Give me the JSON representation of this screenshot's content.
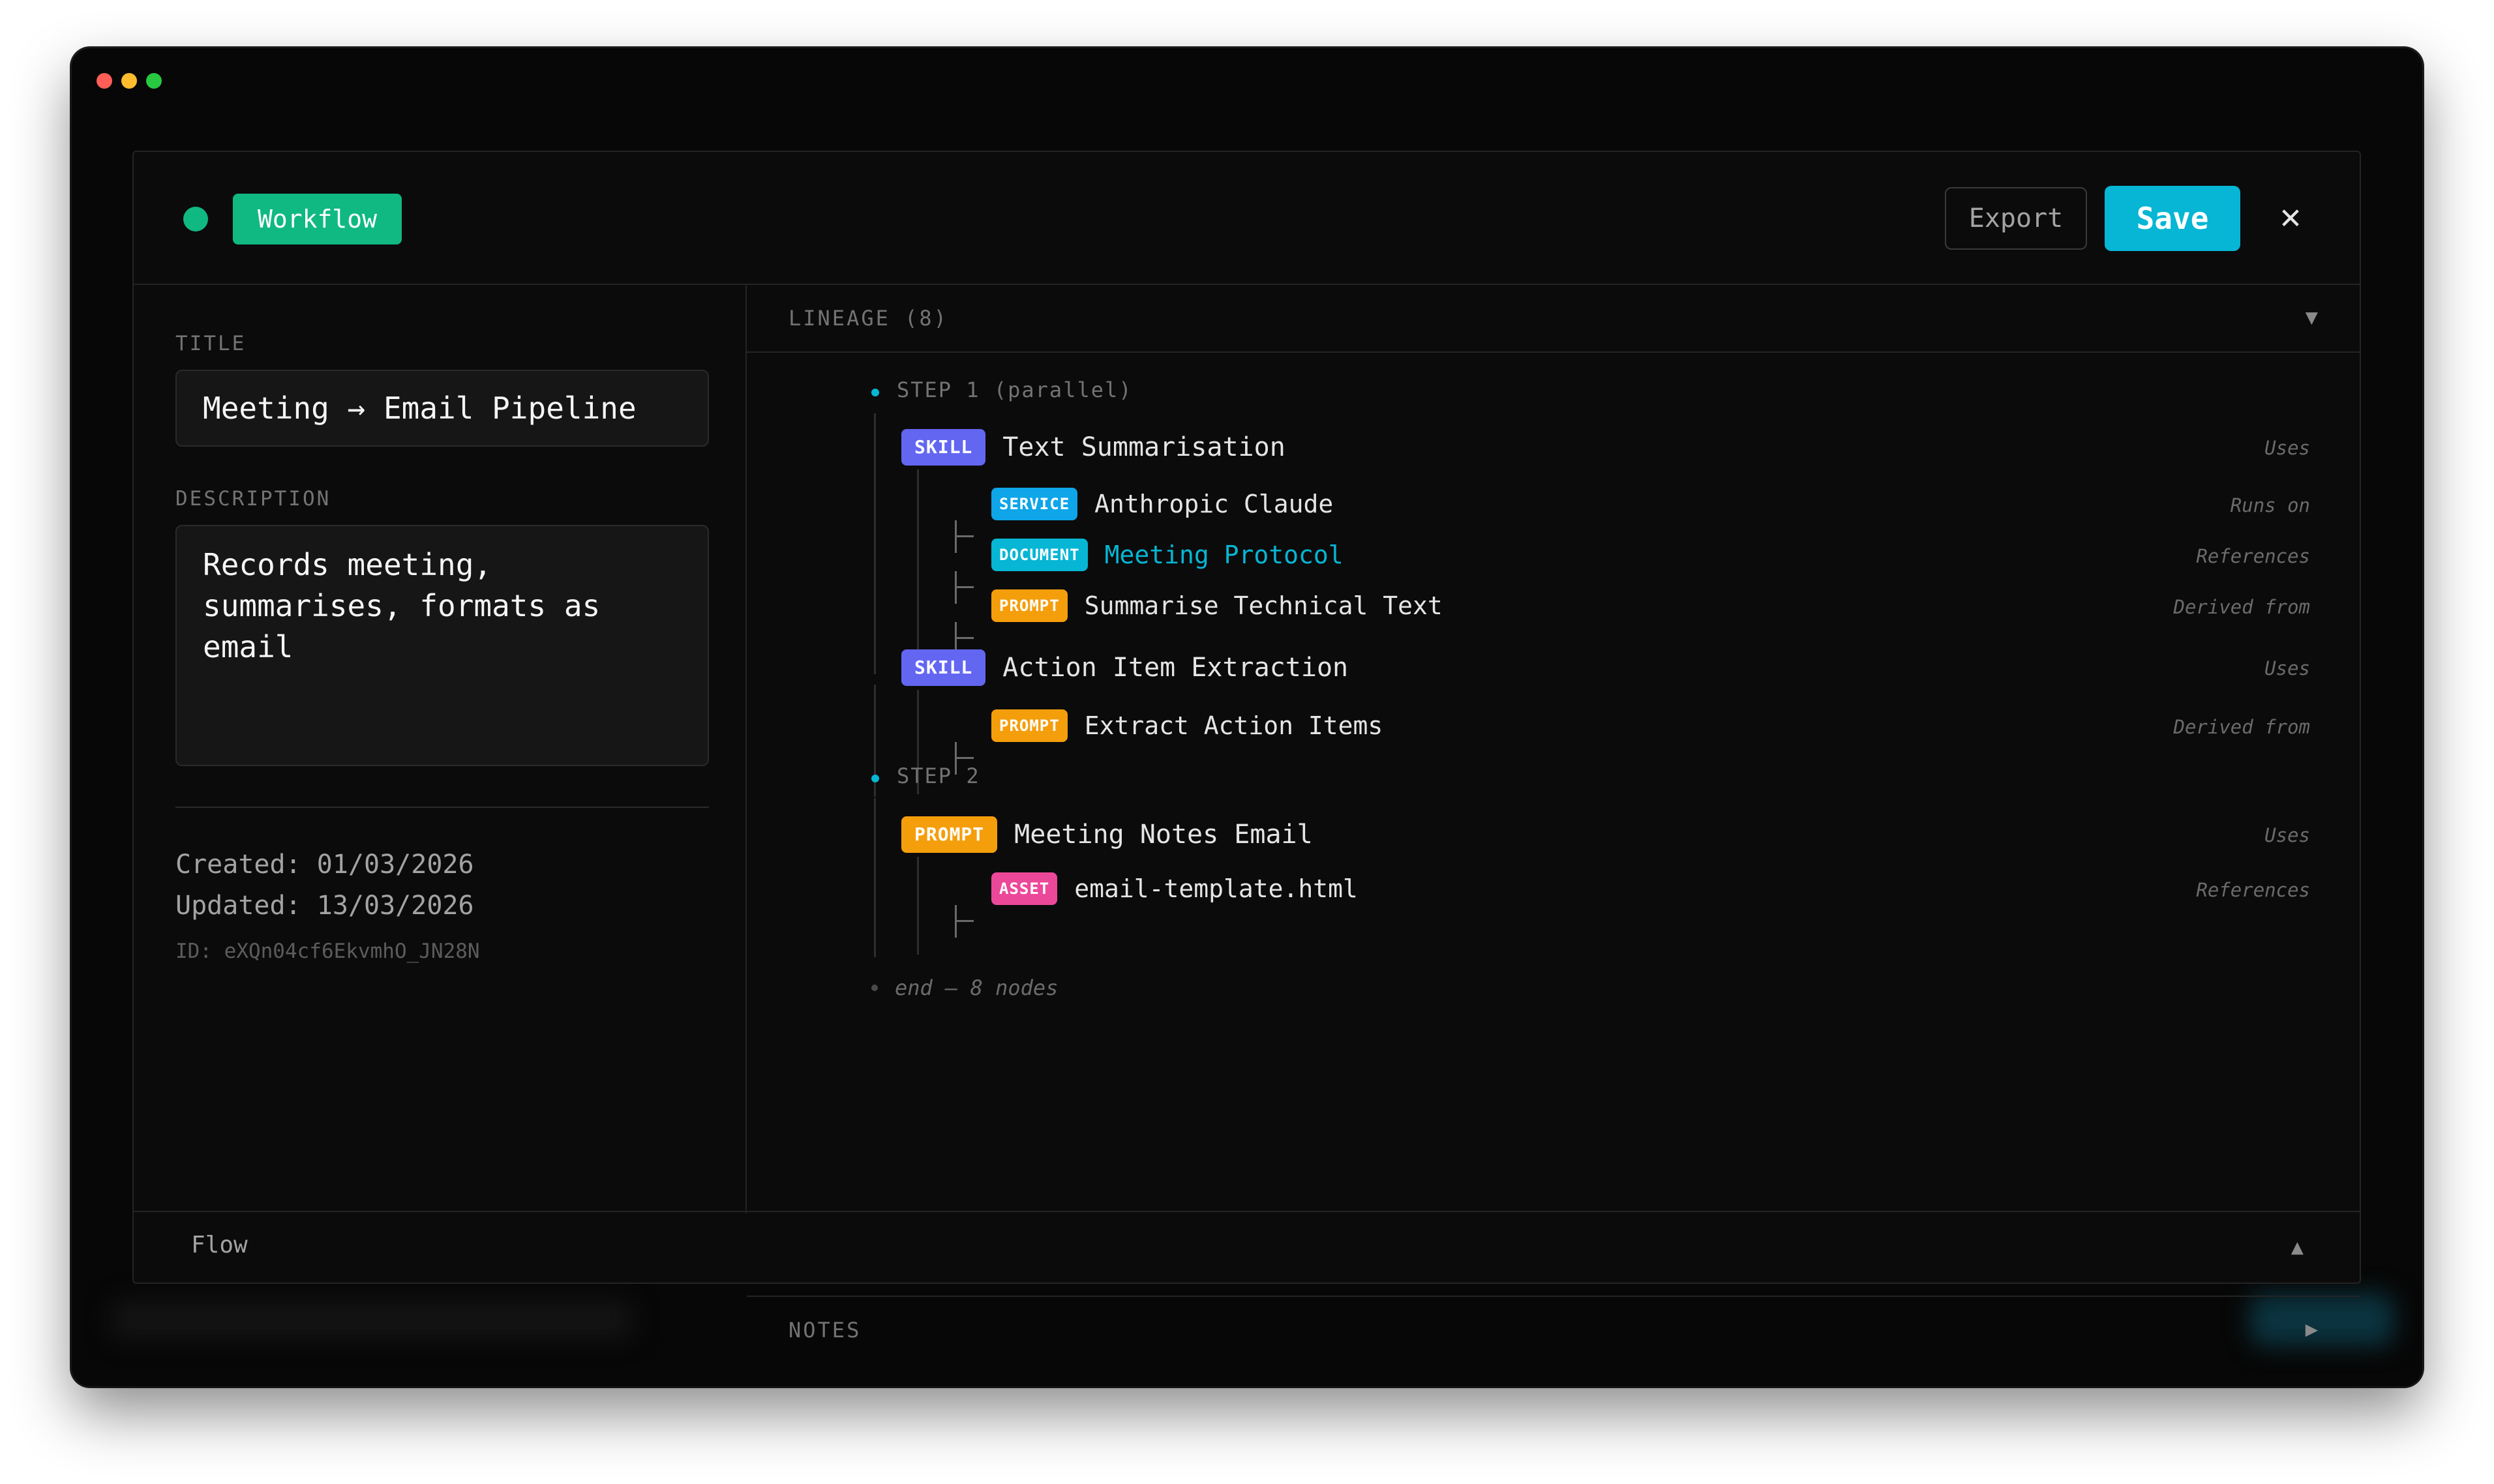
{
  "window": {
    "title": ""
  },
  "header": {
    "type_badge": "Workflow",
    "export_label": "Export",
    "save_label": "Save",
    "close_glyph": "✕",
    "status_color": "#10b981"
  },
  "details": {
    "title_label": "TITLE",
    "title_value": "Meeting → Email Pipeline",
    "description_label": "DESCRIPTION",
    "description_value": "Records meeting, summarises, formats as email",
    "created": "Created: 01/03/2026",
    "updated": "Updated: 13/03/2026",
    "id": "ID: eXQn04cf6EkvmhO_JN28N"
  },
  "lineage": {
    "label": "LINEAGE (8)",
    "caret": "▼",
    "steps": [
      {
        "label": "STEP 1 (parallel)"
      },
      {
        "label": "STEP 2"
      }
    ],
    "nodes": [
      {
        "tag": "SKILL",
        "name": "Text Summarisation",
        "relation": "Uses"
      },
      {
        "tag": "SERVICE",
        "name": "Anthropic Claude",
        "relation": "Runs on"
      },
      {
        "tag": "DOCUMENT",
        "name": "Meeting Protocol",
        "relation": "References"
      },
      {
        "tag": "PROMPT",
        "name": "Summarise Technical Text",
        "relation": "Derived from"
      },
      {
        "tag": "SKILL",
        "name": "Action Item Extraction",
        "relation": "Uses"
      },
      {
        "tag": "PROMPT",
        "name": "Extract Action Items",
        "relation": "Derived from"
      },
      {
        "tag": "PROMPT",
        "name": "Meeting Notes Email",
        "relation": "Uses"
      },
      {
        "tag": "ASSET",
        "name": "email-template.html",
        "relation": "References"
      }
    ],
    "end_text": "end — 8 nodes"
  },
  "notes": {
    "label": "NOTES",
    "caret": "▶"
  },
  "flow": {
    "label": "Flow",
    "caret": "▲"
  }
}
